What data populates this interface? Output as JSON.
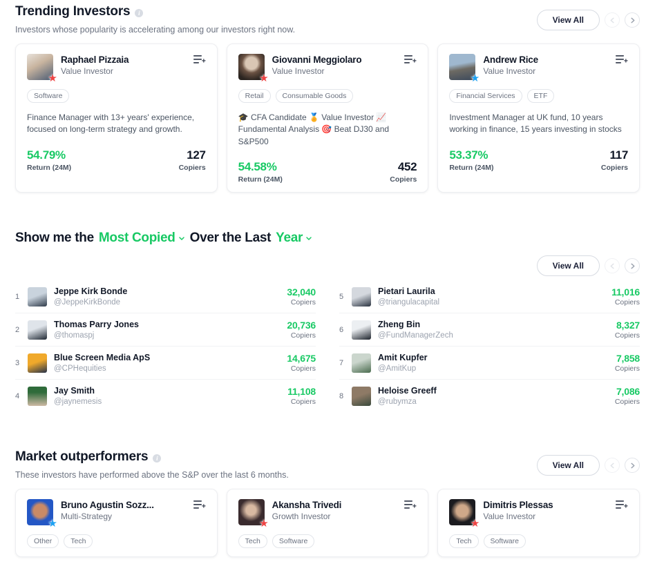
{
  "trending": {
    "title": "Trending Investors",
    "subtitle_pre": "Investors whose popularity is accelerating among our investors right now.",
    "view_all": "View All",
    "cards": [
      {
        "name": "Raphael Pizzaia",
        "role": "Value Investor",
        "badge": "red-star",
        "tags": [
          "Software"
        ],
        "bio": "Finance Manager with 13+ years' experience, focused on long-term strategy and growth.",
        "return_value": "54.79%",
        "return_label": "Return (24M)",
        "copiers_value": "127",
        "copiers_label": "Copiers",
        "avatar_colors": [
          "#c8b49f",
          "#4a5b73"
        ]
      },
      {
        "name": "Giovanni Meggiolaro",
        "role": "Value Investor",
        "badge": "red-star",
        "tags": [
          "Retail",
          "Consumable Goods"
        ],
        "bio": "🎓 CFA Candidate 🏅 Value Investor 📈 Fundamental Analysis 🎯 Beat DJ30 and S&P500",
        "return_value": "54.58%",
        "return_label": "Return (24M)",
        "copiers_value": "452",
        "copiers_label": "Copiers",
        "avatar_colors": [
          "#2b2420",
          "#d9c6b4"
        ]
      },
      {
        "name": "Andrew Rice",
        "role": "Value Investor",
        "badge": "blue-star",
        "tags": [
          "Financial Services",
          "ETF"
        ],
        "bio": "Investment Manager at UK fund, 10 years working in finance, 15 years investing in stocks",
        "return_value": "53.37%",
        "return_label": "Return (24M)",
        "copiers_value": "117",
        "copiers_label": "Copiers",
        "avatar_colors": [
          "#9fb8cf",
          "#3d4a5c"
        ]
      }
    ]
  },
  "filter": {
    "prefix": "Show me the",
    "metric": "Most Copied",
    "middle": "Over the Last",
    "period": "Year",
    "view_all": "View All"
  },
  "ranking": {
    "copiers_label": "Copiers",
    "left": [
      {
        "rank": "1",
        "name": "Jeppe Kirk Bonde",
        "handle": "@JeppeKirkBonde",
        "count": "32,040",
        "avatar_colors": [
          "#c9d3dd",
          "#2f3b4a"
        ]
      },
      {
        "rank": "2",
        "name": "Thomas Parry Jones",
        "handle": "@thomaspj",
        "count": "20,736",
        "avatar_colors": [
          "#dfe4ea",
          "#1f2833"
        ]
      },
      {
        "rank": "3",
        "name": "Blue Screen Media ApS",
        "handle": "@CPHequities",
        "count": "14,675",
        "avatar_colors": [
          "#f0a92b",
          "#24314a"
        ]
      },
      {
        "rank": "4",
        "name": "Jay Smith",
        "handle": "@jaynemesis",
        "count": "11,108",
        "avatar_colors": [
          "#2f6b3a",
          "#cdb9a4"
        ]
      }
    ],
    "right": [
      {
        "rank": "5",
        "name": "Pietari Laurila",
        "handle": "@triangulacapital",
        "count": "11,016",
        "avatar_colors": [
          "#d4d8de",
          "#2a3340"
        ]
      },
      {
        "rank": "6",
        "name": "Zheng Bin",
        "handle": "@FundManagerZech",
        "count": "8,327",
        "avatar_colors": [
          "#eceff2",
          "#1c222b"
        ]
      },
      {
        "rank": "7",
        "name": "Amit Kupfer",
        "handle": "@AmitKup",
        "count": "7,858",
        "avatar_colors": [
          "#cbd6cd",
          "#4a6b4e"
        ]
      },
      {
        "rank": "8",
        "name": "Heloise Greeff",
        "handle": "@rubymza",
        "count": "7,086",
        "avatar_colors": [
          "#8e7a66",
          "#3a4a3c"
        ]
      }
    ]
  },
  "outperformers": {
    "title": "Market outperformers",
    "subtitle": "These investors have performed above the S&P over the last 6 months.",
    "view_all": "View All",
    "cards": [
      {
        "name": "Bruno Agustin Sozz...",
        "role": "Multi-Strategy",
        "badge": "blue-star",
        "tags": [
          "Other",
          "Tech"
        ],
        "avatar_colors": [
          "#2457c5",
          "#c98a66"
        ]
      },
      {
        "name": "Akansha Trivedi",
        "role": "Growth Investor",
        "badge": "red-star",
        "tags": [
          "Tech",
          "Software"
        ],
        "avatar_colors": [
          "#3a2b2e",
          "#d8b9a2"
        ]
      },
      {
        "name": "Dimitris Plessas",
        "role": "Value Investor",
        "badge": "red-star",
        "tags": [
          "Tech",
          "Software"
        ],
        "avatar_colors": [
          "#1b1b1f",
          "#cfa889"
        ]
      }
    ]
  },
  "icons": {
    "info": "i",
    "add_to_list": "add-to-list-icon",
    "chevron_left": "chevron-left-icon",
    "chevron_right": "chevron-right-icon"
  },
  "colors": {
    "accent_green": "#18c964",
    "text_dark": "#111827",
    "text_muted": "#6b7280",
    "badge_red": "#ef4444",
    "badge_blue": "#1da1f2"
  }
}
